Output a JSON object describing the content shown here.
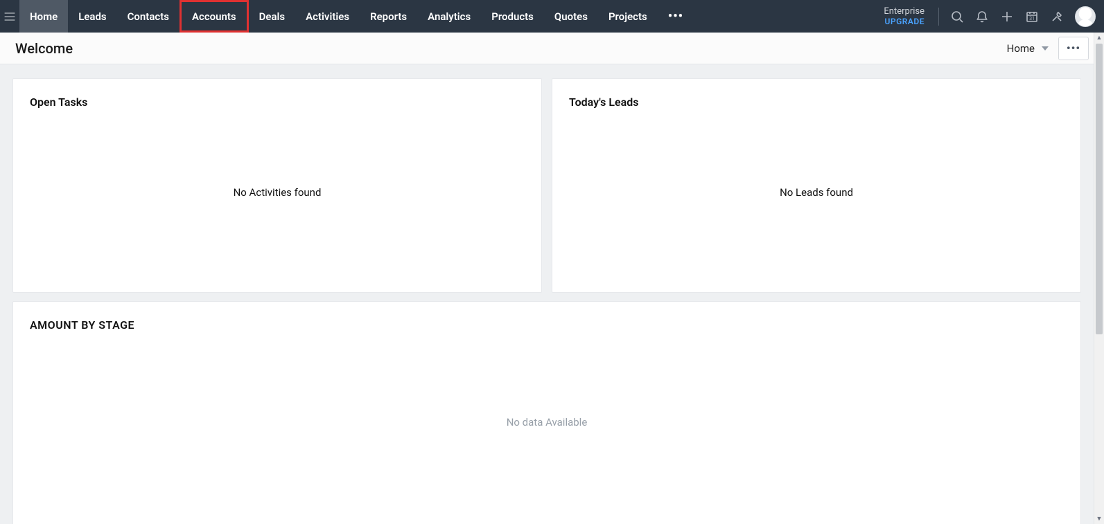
{
  "nav": {
    "tabs": [
      {
        "label": "Home",
        "active": true,
        "highlighted": false
      },
      {
        "label": "Leads",
        "active": false,
        "highlighted": false
      },
      {
        "label": "Contacts",
        "active": false,
        "highlighted": false
      },
      {
        "label": "Accounts",
        "active": false,
        "highlighted": true
      },
      {
        "label": "Deals",
        "active": false,
        "highlighted": false
      },
      {
        "label": "Activities",
        "active": false,
        "highlighted": false
      },
      {
        "label": "Reports",
        "active": false,
        "highlighted": false
      },
      {
        "label": "Analytics",
        "active": false,
        "highlighted": false
      },
      {
        "label": "Products",
        "active": false,
        "highlighted": false
      },
      {
        "label": "Quotes",
        "active": false,
        "highlighted": false
      },
      {
        "label": "Projects",
        "active": false,
        "highlighted": false
      }
    ],
    "more_glyph": "•••",
    "plan": {
      "name": "Enterprise",
      "upgrade_label": "UPGRADE"
    }
  },
  "subheader": {
    "title": "Welcome",
    "view_label": "Home",
    "more_glyph": "•••"
  },
  "cards": {
    "open_tasks": {
      "title": "Open Tasks",
      "empty_text": "No Activities found"
    },
    "todays_leads": {
      "title": "Today's Leads",
      "empty_text": "No Leads found"
    },
    "amount_by_stage": {
      "title": "AMOUNT BY STAGE",
      "empty_text": "No data Available"
    }
  }
}
